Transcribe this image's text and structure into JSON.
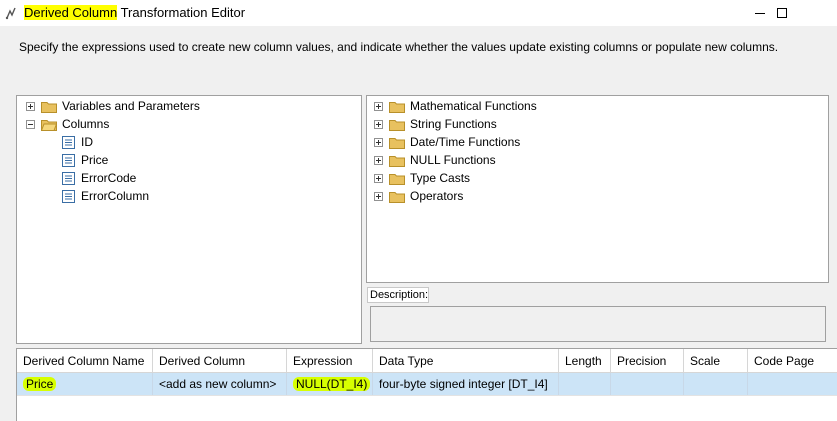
{
  "window": {
    "title_highlight": "Derived Column",
    "title_rest": " Transformation Editor",
    "controls": [
      "minimize-icon",
      "maximize-icon"
    ]
  },
  "instructions": "Specify the expressions used to create new column values, and indicate whether the values update existing columns or populate new columns.",
  "left_tree": {
    "nodes": [
      {
        "label": "Variables and Parameters",
        "state": "collapsed"
      },
      {
        "label": "Columns",
        "state": "expanded"
      }
    ],
    "columns": [
      "ID",
      "Price",
      "ErrorCode",
      "ErrorColumn"
    ]
  },
  "right_tree": {
    "nodes": [
      "Mathematical Functions",
      "String Functions",
      "Date/Time Functions",
      "NULL Functions",
      "Type Casts",
      "Operators"
    ]
  },
  "description": {
    "label": "Description:",
    "value": ""
  },
  "grid": {
    "headers": [
      "Derived Column Name",
      "Derived Column",
      "Expression",
      "Data Type",
      "Length",
      "Precision",
      "Scale",
      "Code Page"
    ],
    "rows": [
      {
        "name": "Price",
        "derived_column": "<add as new column>",
        "expression": "NULL(DT_I4)",
        "data_type": "four-byte signed integer [DT_I4]",
        "length": "",
        "precision": "",
        "scale": "",
        "code_page": ""
      }
    ]
  },
  "colors": {
    "title_highlight": "#ffff00",
    "cell_highlight": "#d7ff00",
    "selected_row": "#cce4f7",
    "folder": "#e8c15f"
  }
}
